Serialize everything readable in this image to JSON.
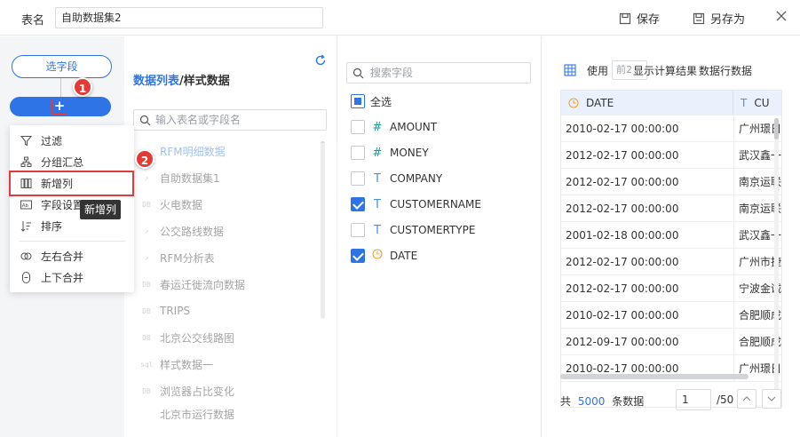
{
  "header": {
    "table_label": "表名",
    "table_name": "自助数据集2",
    "save": "保存",
    "save_as": "另存为"
  },
  "left_rail": {
    "select_field": "选字段",
    "add_symbol": "+",
    "badge1": "1",
    "badge2": "2",
    "menu": [
      {
        "label": "过滤",
        "icon": "filter-icon"
      },
      {
        "label": "分组汇总",
        "icon": "group-icon"
      },
      {
        "label": "新增列",
        "icon": "add-column-icon"
      },
      {
        "label": "字段设置",
        "icon": "field-settings-icon"
      },
      {
        "label": "排序",
        "icon": "sort-icon"
      },
      {
        "label": "左右合并",
        "icon": "merge-horizontal-icon"
      },
      {
        "label": "上下合并",
        "icon": "merge-vertical-icon"
      }
    ],
    "tooltip": "新增列"
  },
  "tables_panel": {
    "title_blue": "数据列表",
    "title_rest": "/样式数据",
    "search_placeholder": "输入表名或字段名",
    "items": [
      {
        "icon": "↗",
        "name": "RFM明细数据"
      },
      {
        "icon": "↗",
        "name": "自助数据集1"
      },
      {
        "icon": "DB",
        "name": "火电数据"
      },
      {
        "icon": "↗",
        "name": "公交路线数据"
      },
      {
        "icon": "↗",
        "name": "RFM分析表"
      },
      {
        "icon": "DB",
        "name": "春运迁徙流向数据"
      },
      {
        "icon": "DB",
        "name": "TRIPS"
      },
      {
        "icon": "DB",
        "name": "北京公交线路图"
      },
      {
        "icon": "sql",
        "name": "样式数据一"
      },
      {
        "icon": "DB",
        "name": "浏览器占比变化"
      },
      {
        "icon": "",
        "name": "北京市运行数据"
      }
    ]
  },
  "fields_panel": {
    "search_placeholder": "搜索字段",
    "select_all": "全选",
    "fields": [
      {
        "type": "#",
        "name": "AMOUNT",
        "checked": false
      },
      {
        "type": "#",
        "name": "MONEY",
        "checked": false
      },
      {
        "type": "T",
        "name": "COMPANY",
        "checked": false
      },
      {
        "type": "T",
        "name": "CUSTOMERNAME",
        "checked": true
      },
      {
        "type": "T",
        "name": "CUSTOMERTYPE",
        "checked": false
      },
      {
        "type": "date",
        "name": "DATE",
        "checked": true
      }
    ]
  },
  "preview": {
    "use_label": "使用",
    "rows_select": "前2",
    "show_calc": "显示计算结果",
    "rows_label": "数据行数据",
    "columns": [
      "DATE",
      "CU"
    ],
    "rows": [
      [
        "2010-02-17 00:00:00",
        "广州璟日"
      ],
      [
        "2012-02-17 00:00:00",
        "武汉鑫一"
      ],
      [
        "2012-02-17 00:00:00",
        "南京运联"
      ],
      [
        "2012-02-17 00:00:00",
        "南京运联"
      ],
      [
        "2001-02-18 00:00:00",
        "武汉鑫一"
      ],
      [
        "2012-02-17 00:00:00",
        "广州市捷"
      ],
      [
        "2012-02-17 00:00:00",
        "宁波金诚"
      ],
      [
        "2010-02-17 00:00:00",
        "合肥顺成"
      ],
      [
        "2012-09-17 00:00:00",
        "合肥顺成"
      ],
      [
        "2010-02-17 00:00:00",
        "广州璟日"
      ]
    ],
    "total_prefix": "共",
    "total_count": "5000",
    "total_suffix": "条数据",
    "page": "1",
    "page_total": "/50"
  },
  "colors": {
    "accent": "#2f74e6",
    "annotation_red": "#e23b3b",
    "header_bg": "#e9f1fd"
  }
}
